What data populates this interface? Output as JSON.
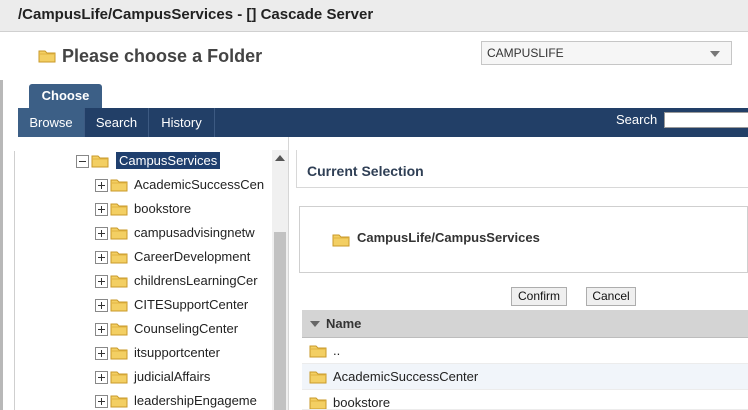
{
  "window": {
    "title": "/CampusLife/CampusServices - [] Cascade Server"
  },
  "header": {
    "title": "Please choose a Folder",
    "site_select_value": "CAMPUSLIFE"
  },
  "tab": {
    "label": "Choose"
  },
  "nav": {
    "browse": "Browse",
    "search": "Search",
    "history": "History",
    "search_label": "Search",
    "search_placeholder": ""
  },
  "tree": {
    "root_label": "CampusServices",
    "items": [
      {
        "label": "AcademicSuccessCen"
      },
      {
        "label": "bookstore"
      },
      {
        "label": "campusadvisingnetw"
      },
      {
        "label": "CareerDevelopment"
      },
      {
        "label": "childrensLearningCer"
      },
      {
        "label": "CITESupportCenter"
      },
      {
        "label": "CounselingCenter"
      },
      {
        "label": "itsupportcenter"
      },
      {
        "label": "judicialAffairs"
      },
      {
        "label": "leadershipEngageme"
      }
    ]
  },
  "current_selection": {
    "heading": "Current Selection",
    "path": "CampusLife/CampusServices"
  },
  "buttons": {
    "confirm": "Confirm",
    "cancel": "Cancel"
  },
  "list": {
    "header": "Name",
    "rows": [
      {
        "name": ".."
      },
      {
        "name": "AcademicSuccessCenter"
      },
      {
        "name": "bookstore"
      }
    ]
  },
  "colors": {
    "navbar": "#223f67",
    "tab_active": "#3c5f86",
    "selection": "#1f3f6e",
    "folder": "#f2c94c"
  },
  "icons": {
    "folder": "folder-icon",
    "expand": "plus-box-icon",
    "collapse": "minus-box-icon"
  }
}
